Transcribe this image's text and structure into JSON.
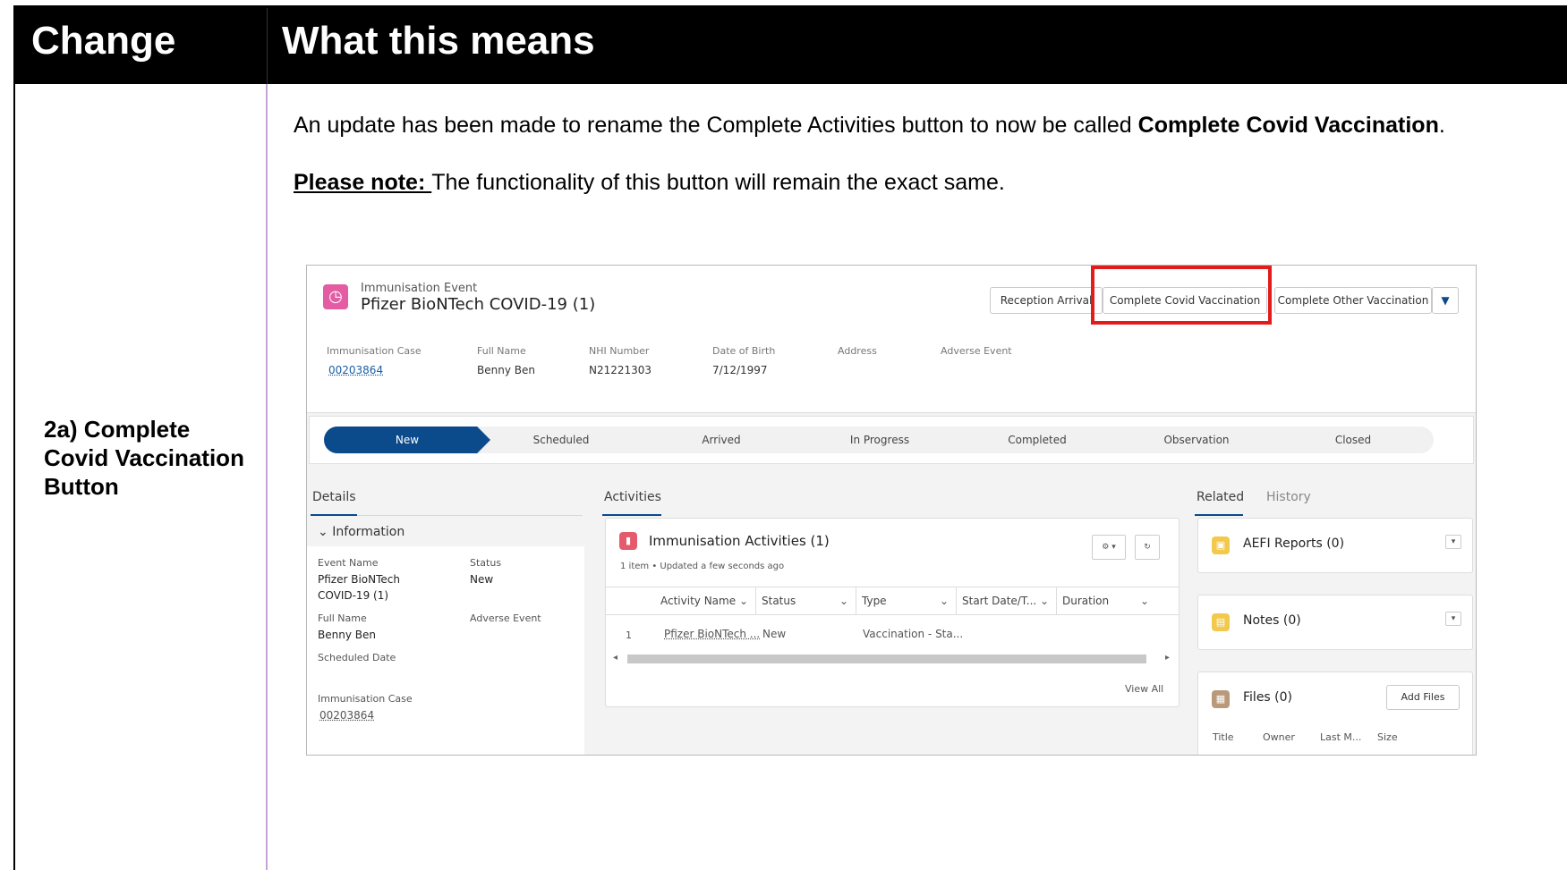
{
  "table": {
    "col1_header": "Change",
    "col2_header": "What this means",
    "row_label": "2a) Complete Covid Vaccination Button"
  },
  "text": {
    "p1_pre": "An update has been made to rename the Complete Activities button to now be called ",
    "p1_bold": "Complete Covid Vaccination",
    "p1_post": ".",
    "note_label": "Please note: ",
    "note_text": "The functionality of this button will remain the exact same."
  },
  "record": {
    "object_label": "Immunisation Event",
    "title": "Pfizer BioNTech COVID-19 (1)",
    "buttons": [
      "Reception Arrival",
      "Complete Covid Vaccination",
      "Complete Other Vaccination"
    ],
    "fields": [
      {
        "label": "Immunisation Case",
        "value": "00203864"
      },
      {
        "label": "Full Name",
        "value": "Benny Ben"
      },
      {
        "label": "NHI Number",
        "value": "N21221303"
      },
      {
        "label": "Date of Birth",
        "value": "7/12/1997"
      },
      {
        "label": "Address",
        "value": ""
      },
      {
        "label": "Adverse Event",
        "value": ""
      }
    ],
    "path": [
      "New",
      "Scheduled",
      "Arrived",
      "In Progress",
      "Completed",
      "Observation",
      "Closed"
    ]
  },
  "details": {
    "tab": "Details",
    "section": "Information",
    "event_name_label": "Event Name",
    "event_name_line1": "Pfizer BioNTech",
    "event_name_line2": "COVID-19 (1)",
    "status_label": "Status",
    "status_value": "New",
    "full_name_label": "Full Name",
    "full_name_value": "Benny Ben",
    "adverse_label": "Adverse Event",
    "scheduled_label": "Scheduled Date",
    "case_label": "Immunisation Case",
    "case_value": "00203864"
  },
  "activities": {
    "tab": "Activities",
    "card_title": "Immunisation Activities (1)",
    "subtitle": "1 item • Updated a few seconds ago",
    "columns": [
      "Activity Name",
      "Status",
      "Type",
      "Start Date/T...",
      "Duration"
    ],
    "row": {
      "num": "1",
      "name": "Pfizer BioNTech ...",
      "status": "New",
      "type": "Vaccination - Sta..."
    },
    "view_all": "View All"
  },
  "related": {
    "tabs": [
      "Related",
      "History"
    ],
    "aefi": "AEFI Reports (0)",
    "notes": "Notes (0)",
    "files": "Files (0)",
    "add_files": "Add Files",
    "file_cols": [
      "Title",
      "Owner",
      "Last M...",
      "Size"
    ]
  }
}
